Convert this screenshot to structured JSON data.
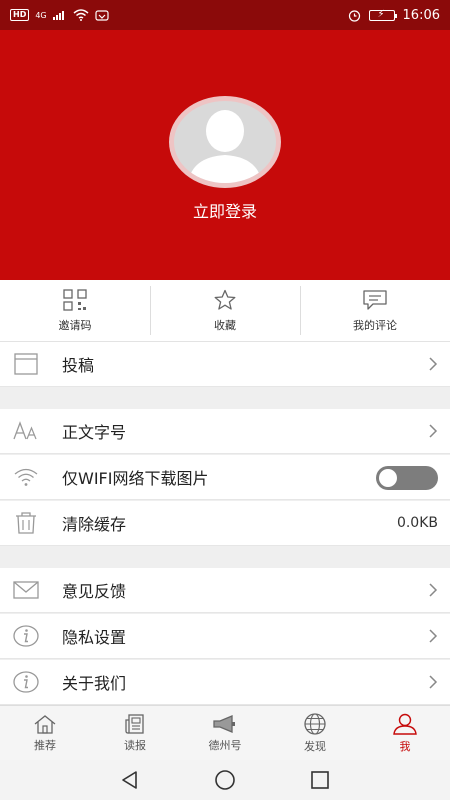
{
  "status_bar": {
    "hd": "HD",
    "network": "4G",
    "time": "16:06",
    "icons": [
      "signal-icon",
      "wifi-icon",
      "app-notification-icon",
      "alarm-icon",
      "battery-icon"
    ]
  },
  "profile": {
    "login_label": "立即登录",
    "icons": [
      "default-avatar-icon"
    ]
  },
  "shortcuts": [
    {
      "label": "邀请码",
      "icon": "qr-code-icon"
    },
    {
      "label": "收藏",
      "icon": "star-icon"
    },
    {
      "label": "我的评论",
      "icon": "comment-icon"
    }
  ],
  "menu": {
    "submit": {
      "label": "投稿",
      "icon": "calendar-window-icon"
    },
    "font_size": {
      "label": "正文字号",
      "icon": "font-size-icon"
    },
    "wifi_only": {
      "label": "仅WIFI网络下载图片",
      "icon": "wifi-icon",
      "enabled": false
    },
    "clear_cache": {
      "label": "清除缓存",
      "value": "0.0KB",
      "icon": "trash-icon"
    },
    "feedback": {
      "label": "意见反馈",
      "icon": "mail-icon"
    },
    "privacy": {
      "label": "隐私设置",
      "icon": "info-icon"
    },
    "about": {
      "label": "关于我们",
      "icon": "info-icon"
    }
  },
  "tabs": [
    {
      "label": "推荐",
      "icon": "home-icon",
      "active": false
    },
    {
      "label": "读报",
      "icon": "newspaper-icon",
      "active": false
    },
    {
      "label": "德州号",
      "icon": "megaphone-icon",
      "active": false
    },
    {
      "label": "发现",
      "icon": "globe-icon",
      "active": false
    },
    {
      "label": "我",
      "icon": "user-icon",
      "active": true
    }
  ],
  "nav_bar": {
    "icons": [
      "back-icon",
      "home-circle-icon",
      "recent-apps-icon"
    ]
  },
  "colors": {
    "status_bar": "#8b0a0a",
    "header": "#c60a0a",
    "active_tab": "#c60a0a",
    "toggle_off": "#7d7d7d"
  }
}
